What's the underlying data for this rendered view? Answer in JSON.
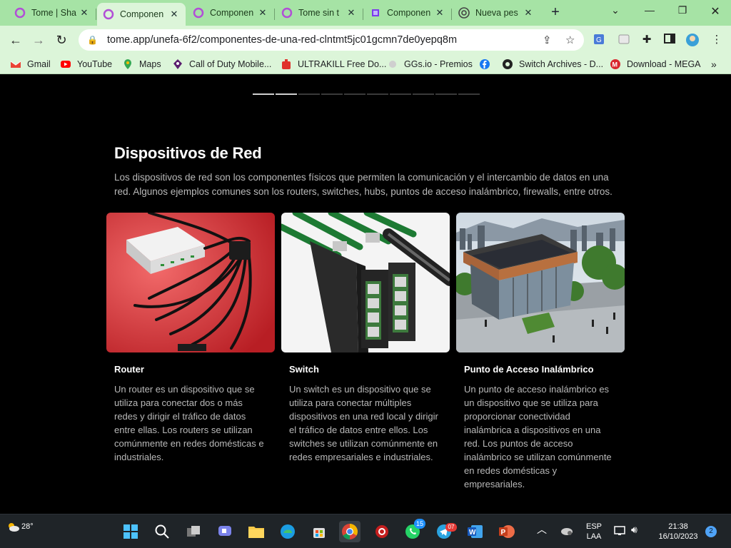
{
  "browser": {
    "tabs": [
      {
        "label": "Tome | Sha",
        "active": false
      },
      {
        "label": "Componen",
        "active": true
      },
      {
        "label": "Componen",
        "active": false
      },
      {
        "label": "Tome sin t",
        "active": false
      },
      {
        "label": "Componen",
        "active": false
      },
      {
        "label": "Nueva pes",
        "active": false
      }
    ],
    "url": "tome.app/unefa-6f2/componentes-de-una-red-clntmt5jc01gcmn7de0yepq8m",
    "bookmarks": [
      "Gmail",
      "YouTube",
      "Maps",
      "Call of Duty Mobile...",
      "ULTRAKILL Free Do...",
      "GGs.io - Premios",
      "Switch Archives - D...",
      "Download - MEGA"
    ],
    "bookmarks_more": "»",
    "colors": {
      "frame": "#a6e3a5",
      "toolbar": "#dcf5d9"
    }
  },
  "slide": {
    "progress_total": 10,
    "progress_done": 2,
    "title": "Dispositivos de Red",
    "intro": "Los dispositivos de red son los componentes físicos que permiten la comunicación y el intercambio de datos en una red. Algunos ejemplos comunes son los routers, switches, hubs, puntos de acceso inalámbrico, firewalls, entre otros.",
    "cards": [
      {
        "title": "Router",
        "text": "Un router es un dispositivo que se utiliza para conectar dos o más redes y dirigir el tráfico de datos entre ellas. Los routers se utilizan comúnmente en redes domésticas e industriales.",
        "image": "router-image"
      },
      {
        "title": "Switch",
        "text": "Un switch es un dispositivo que se utiliza para conectar múltiples dispositivos en una red local y dirigir el tráfico de datos entre ellos. Los switches se utilizan comúnmente en redes empresariales e industriales.",
        "image": "switch-image"
      },
      {
        "title": "Punto de Acceso Inalámbrico",
        "text": "Un punto de acceso inalámbrico es un dispositivo que se utiliza para proporcionar conectividad inalámbrica a dispositivos en una red. Los puntos de acceso inalámbrico se utilizan comúnmente en redes domésticas y empresariales.",
        "image": "building-image"
      }
    ]
  },
  "taskbar": {
    "weather": "28°",
    "lang": "ESP",
    "layout": "LAA",
    "time": "21:38",
    "date": "16/10/2023",
    "notifications": "2",
    "whatsapp_badge": "15",
    "telegram_badge": "07"
  }
}
